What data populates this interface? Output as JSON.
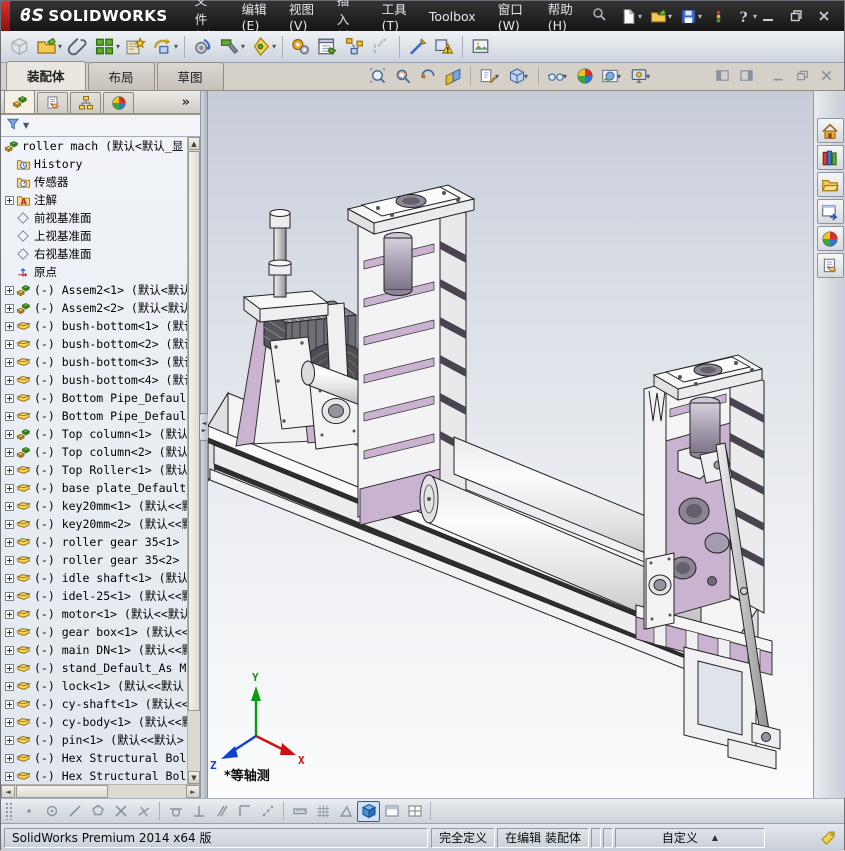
{
  "title_bar": {
    "logo_mark": "ϐS",
    "logo_text": "SOLIDWORKS",
    "menus": [
      "文件(F)",
      "编辑(E)",
      "视图(V)",
      "插入(I)",
      "工具(T)",
      "Toolbox",
      "窗口(W)",
      "帮助(H)"
    ],
    "quick_icons": [
      {
        "name": "new-document",
        "caret": true
      },
      {
        "name": "open-document",
        "caret": true
      },
      {
        "name": "save",
        "caret": true
      },
      {
        "name": "performance",
        "caret": false
      },
      {
        "name": "help",
        "caret": true
      }
    ],
    "window_controls": [
      "minimize",
      "restore",
      "close"
    ]
  },
  "assembly_toolbar": {
    "buttons": [
      {
        "name": "insert-component",
        "gray": true
      },
      {
        "name": "open-document",
        "caret": true
      },
      {
        "name": "mate"
      },
      {
        "name": "component-pattern",
        "caret": true
      },
      {
        "name": "smart-fasteners"
      },
      {
        "name": "move-component",
        "caret": true
      },
      {
        "sep": true
      },
      {
        "name": "smart-components"
      },
      {
        "name": "assembly-features",
        "caret": true
      },
      {
        "name": "reference-geometry",
        "caret": true
      },
      {
        "sep": true
      },
      {
        "name": "motion-study"
      },
      {
        "name": "bill-of-materials"
      },
      {
        "name": "exploded-view"
      },
      {
        "name": "explode-line-sketch",
        "gray": true
      },
      {
        "sep": true
      },
      {
        "name": "instant-3d"
      },
      {
        "name": "assembly-xpert"
      },
      {
        "sep": true
      },
      {
        "name": "take-snapshot"
      }
    ]
  },
  "command_tabs": {
    "tabs": [
      {
        "label": "装配体",
        "active": true
      },
      {
        "label": "布局",
        "active": false
      },
      {
        "label": "草图",
        "active": false
      }
    ]
  },
  "heads_up": [
    {
      "name": "zoom-to-fit"
    },
    {
      "name": "zoom-to-area"
    },
    {
      "name": "previous-view"
    },
    {
      "name": "section-view"
    },
    {
      "sep": true
    },
    {
      "name": "view-orientation",
      "caret": true
    },
    {
      "name": "display-style",
      "caret": true
    },
    {
      "sep": true
    },
    {
      "name": "hide-show-items",
      "caret": true
    },
    {
      "name": "edit-appearance"
    },
    {
      "name": "apply-scene",
      "caret": true
    },
    {
      "name": "view-settings",
      "caret": true
    }
  ],
  "doc_window_controls": [
    "pane-left",
    "pane-right",
    "doc-minimize",
    "doc-restore",
    "doc-close"
  ],
  "feature_panel": {
    "panel_tabs": [
      {
        "name": "featuremanager",
        "active": true
      },
      {
        "name": "propertymanager",
        "active": false
      },
      {
        "name": "configurationmanager",
        "active": false
      },
      {
        "name": "displaymanager",
        "active": false
      }
    ],
    "overflow_label": "»",
    "tree": {
      "root": {
        "label": "roller mach (默认<默认_显",
        "icon": "t-assembly"
      },
      "items": [
        {
          "label": "History",
          "icon": "t-history",
          "expand": false
        },
        {
          "label": "传感器",
          "icon": "t-sensors",
          "expand": false
        },
        {
          "label": "注解",
          "icon": "t-annotations",
          "expand": true
        },
        {
          "label": "前视基准面",
          "icon": "t-plane",
          "expand": false
        },
        {
          "label": "上视基准面",
          "icon": "t-plane",
          "expand": false
        },
        {
          "label": "右视基准面",
          "icon": "t-plane",
          "expand": false
        },
        {
          "label": "原点",
          "icon": "t-origin",
          "expand": false
        },
        {
          "label": "(-) Assem2<1> (默认<默认",
          "icon": "t-subassembly",
          "expand": true
        },
        {
          "label": "(-) Assem2<2> (默认<默认",
          "icon": "t-subassembly",
          "expand": true
        },
        {
          "label": "(-) bush-bottom<1> (默认",
          "icon": "t-part",
          "expand": true
        },
        {
          "label": "(-) bush-bottom<2> (默认",
          "icon": "t-part",
          "expand": true
        },
        {
          "label": "(-) bush-bottom<3> (默认",
          "icon": "t-part",
          "expand": true
        },
        {
          "label": "(-) bush-bottom<4> (默认",
          "icon": "t-part",
          "expand": true
        },
        {
          "label": "(-) Bottom Pipe_Default",
          "icon": "t-part",
          "expand": true
        },
        {
          "label": "(-) Bottom Pipe_Default",
          "icon": "t-part",
          "expand": true
        },
        {
          "label": "(-) Top column<1> (默认",
          "icon": "t-subassembly",
          "expand": true
        },
        {
          "label": "(-) Top column<2> (默认",
          "icon": "t-subassembly",
          "expand": true
        },
        {
          "label": "(-) Top Roller<1> (默认",
          "icon": "t-part",
          "expand": true
        },
        {
          "label": "(-) base plate_Default_",
          "icon": "t-part",
          "expand": true
        },
        {
          "label": "(-) key20mm<1> (默认<<默",
          "icon": "t-part",
          "expand": true
        },
        {
          "label": "(-) key20mm<2> (默认<<默",
          "icon": "t-part",
          "expand": true
        },
        {
          "label": "(-) roller gear 35<1> (",
          "icon": "t-part",
          "expand": true
        },
        {
          "label": "(-) roller gear 35<2> (",
          "icon": "t-part",
          "expand": true
        },
        {
          "label": "(-) idle shaft<1> (默认",
          "icon": "t-part",
          "expand": true
        },
        {
          "label": "(-) idel-25<1> (默认<<默",
          "icon": "t-part",
          "expand": true
        },
        {
          "label": "(-) motor<1> (默认<<默认",
          "icon": "t-part",
          "expand": true
        },
        {
          "label": "(-) gear box<1> (默认<<",
          "icon": "t-part",
          "expand": true
        },
        {
          "label": "(-) main DN<1> (默认<<默",
          "icon": "t-part",
          "expand": true
        },
        {
          "label": "(-) stand_Default_As Ma",
          "icon": "t-part",
          "expand": true
        },
        {
          "label": "(-) lock<1> (默认<<默认",
          "icon": "t-part",
          "expand": true
        },
        {
          "label": "(-) cy-shaft<1> (默认<<",
          "icon": "t-part",
          "expand": true
        },
        {
          "label": "(-) cy-body<1> (默认<<默",
          "icon": "t-part",
          "expand": true
        },
        {
          "label": "(-) pin<1> (默认<<默认>",
          "icon": "t-part",
          "expand": true
        },
        {
          "label": "(-) Hex Structural Bolt",
          "icon": "t-part",
          "expand": true
        },
        {
          "label": "(-) Hex Structural Bolt",
          "icon": "t-part",
          "expand": true
        }
      ]
    }
  },
  "viewport": {
    "view_label": "*等轴测",
    "triad": {
      "x": "X",
      "y": "Y",
      "z": "Z"
    },
    "accent_color": "#c9b3d0"
  },
  "task_pane": [
    "solidworks-resources",
    "design-library",
    "file-explorer",
    "view-palette",
    "appearances-scenes",
    "custom-properties"
  ],
  "snap_toolbar": [
    {
      "name": "point"
    },
    {
      "name": "center"
    },
    {
      "name": "line"
    },
    {
      "name": "quadrant"
    },
    {
      "name": "intersection"
    },
    {
      "name": "nearest"
    },
    {
      "sep": true
    },
    {
      "name": "tangent"
    },
    {
      "name": "perpendicular"
    },
    {
      "name": "parallel"
    },
    {
      "name": "horizontal-vertical"
    },
    {
      "name": "sketch-points"
    },
    {
      "sep": true
    },
    {
      "name": "length"
    },
    {
      "name": "grid"
    },
    {
      "name": "angle"
    },
    {
      "name": "shaded-cube",
      "active": true
    },
    {
      "name": "split-horizontal"
    },
    {
      "name": "split-grid"
    },
    {
      "sep": true
    }
  ],
  "status_bar": {
    "left": "SolidWorks Premium 2014 x64 版",
    "defined": "完全定义",
    "editing": "在编辑 装配体",
    "custom": "自定义"
  }
}
